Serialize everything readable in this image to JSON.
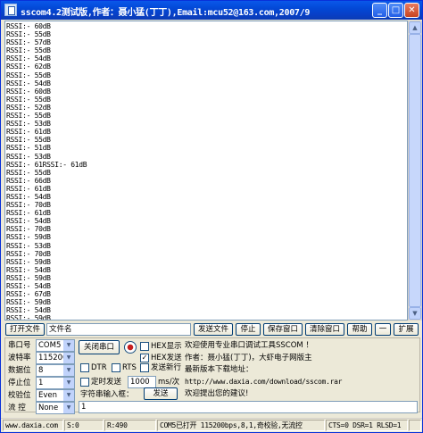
{
  "window": {
    "title": "sscom4.2测试版,作者：聂小猛(丁丁),Email:mcu52@163.com,2007/9",
    "minimize": "_",
    "maximize": "□",
    "close": "✕"
  },
  "log_lines": [
    "RSSI:- 60dB",
    "RSSI:- 55dB",
    "RSSI:- 57dB",
    "RSSI:- 55dB",
    "RSSI:- 54dB",
    "RSSI:- 62dB",
    "RSSI:- 55dB",
    "RSSI:- 54dB",
    "RSSI:- 60dB",
    "RSSI:- 55dB",
    "RSSI:- 52dB",
    "RSSI:- 55dB",
    "RSSI:- 53dB",
    "RSSI:- 61dB",
    "RSSI:- 55dB",
    "RSSI:- 51dB",
    "RSSI:- 53dB",
    "RSSI:- 61RSSI:- 61dB",
    "RSSI:- 55dB",
    "RSSI:- 66dB",
    "RSSI:- 61dB",
    "RSSI:- 54dB",
    "RSSI:- 70dB",
    "RSSI:- 61dB",
    "RSSI:- 54dB",
    "RSSI:- 70dB",
    "RSSI:- 59dB",
    "RSSI:- 53dB",
    "RSSI:- 70dB",
    "RSSI:- 59dB",
    "RSSI:- 54dB",
    "RSSI:- 59dB",
    "RSSI:- 54dB",
    "RSSI:- 67dB",
    "RSSI:- 59dB",
    "RSSI:- 54dB",
    "RSSI:- 59dB"
  ],
  "toolbar": {
    "open_file": "打开文件",
    "filename": "文件名",
    "send_file": "发送文件",
    "stop": "停止",
    "save_window": "保存窗口",
    "clear_window": "清除窗口",
    "help": "帮助",
    "collapse": "一",
    "expand": "扩展"
  },
  "settings": {
    "port_label": "串口号",
    "port_value": "COM5",
    "baud_label": "波特率",
    "baud_value": "115200",
    "databits_label": "数据位",
    "databits_value": "8",
    "stopbits_label": "停止位",
    "stopbits_value": "1",
    "parity_label": "校验位",
    "parity_value": "Even",
    "flow_label": "流 控",
    "flow_value": "None"
  },
  "controls": {
    "close_port": "关闭串口",
    "hex_display": "HEX显示",
    "hex_send": "HEX发送",
    "dtr": "DTR",
    "rts": "RTS",
    "send_newline": "发送新行",
    "timed_send": "定时发送",
    "interval_value": "1000",
    "interval_unit": "ms/次",
    "input_label": "字符串输入框：",
    "send_button": "发送",
    "send_input": "1"
  },
  "info": {
    "line1": "欢迎使用专业串口调试工具SSCOM ！",
    "line2": "作者：聂小猛(丁丁)，大虾电子网版主",
    "line3": "最新版本下载地址：",
    "line4": "http://www.daxia.com/download/sscom.rar",
    "line5": "欢迎提出您的建议!"
  },
  "status": {
    "site": "www.daxia.com",
    "sent": "S:0",
    "received": "R:490",
    "port_status": "COM5已打开  115200bps,8,1,奇校验,无流控",
    "signals": "CTS=0 DSR=1 RLSD=1"
  }
}
